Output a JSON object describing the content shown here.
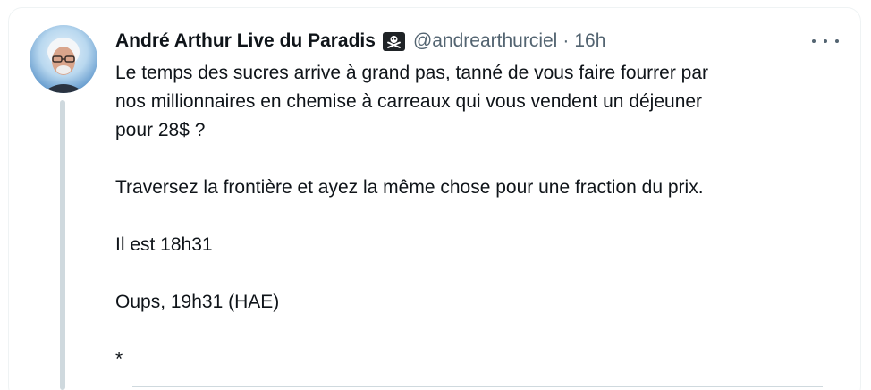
{
  "author": {
    "display_name": "André Arthur Live du Paradis",
    "badge_icon": "skull-crossbones-icon",
    "handle": "@andrearthurciel",
    "separator": "·",
    "timestamp": "16h"
  },
  "menu": {
    "icon": "more-options-icon"
  },
  "tweet": {
    "lines": [
      "Le temps des sucres arrive à  grand pas, tanné de vous faire fourrer par",
      "nos millionnaires en chemise à  carreaux qui vous vendent un déjeuner",
      "pour 28$ ?"
    ],
    "paragraph_2": "Traversez la frontière et ayez la même chose pour une fraction du prix.",
    "paragraph_3": "Il est 18h31",
    "paragraph_4": "Oups, 19h31 (HAE)",
    "paragraph_5": "*"
  },
  "colors": {
    "text_primary": "#0f1419",
    "text_secondary": "#536471",
    "thread_line": "#cfd9de"
  }
}
